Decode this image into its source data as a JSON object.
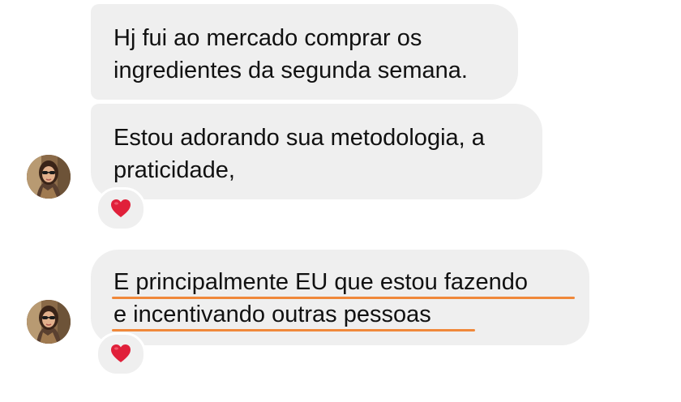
{
  "messages": [
    {
      "lines": [
        "Hj fui ao mercado comprar os",
        "ingredientes da segunda semana."
      ],
      "reaction": null
    },
    {
      "lines": [
        "Estou adorando sua metodologia, a",
        "praticidade,"
      ],
      "reaction": "heart-icon"
    },
    {
      "lines": [
        "E principalmente EU que estou fazendo",
        "e incentivando outras pessoas"
      ],
      "reaction": "heart-icon",
      "highlight_color": "#f0883a"
    }
  ],
  "colors": {
    "bubble_background": "#efefef",
    "text": "#111111",
    "heart": "#e0203a",
    "underline": "#f0883a"
  }
}
